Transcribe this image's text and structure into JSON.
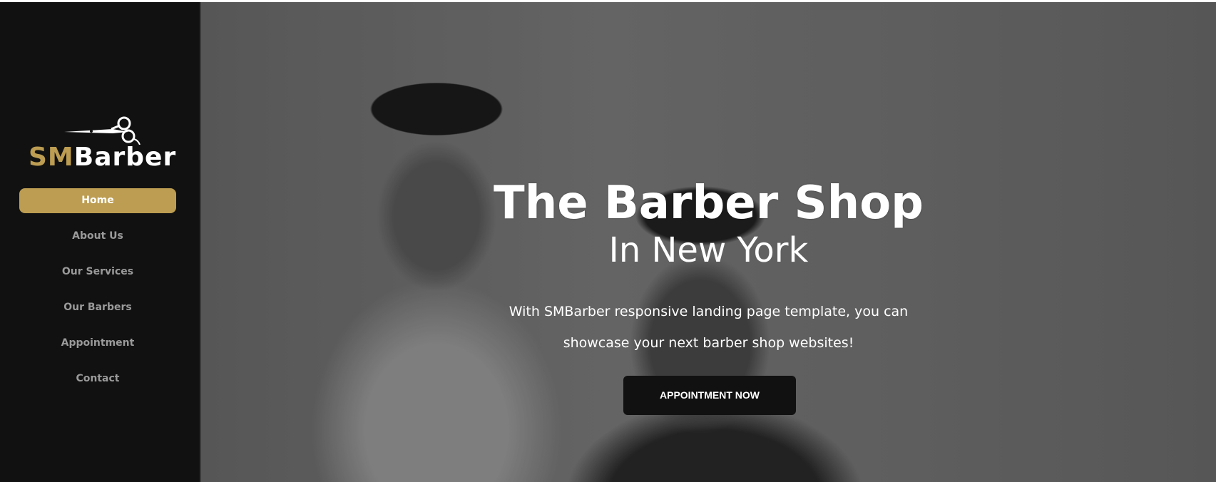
{
  "logo": {
    "part1": "SM",
    "part2": "Barber"
  },
  "nav": {
    "items": [
      {
        "label": "Home"
      },
      {
        "label": "About Us"
      },
      {
        "label": "Our Services"
      },
      {
        "label": "Our Barbers"
      },
      {
        "label": "Appointment"
      },
      {
        "label": "Contact"
      }
    ]
  },
  "hero": {
    "title": "The Barber Shop",
    "subtitle": "In New York",
    "description": "With SMBarber responsive landing page template, you can showcase your next barber shop websites!",
    "cta": "APPOINTMENT NOW"
  },
  "colors": {
    "accent": "#bc9d52",
    "sidebar": "#111111"
  }
}
